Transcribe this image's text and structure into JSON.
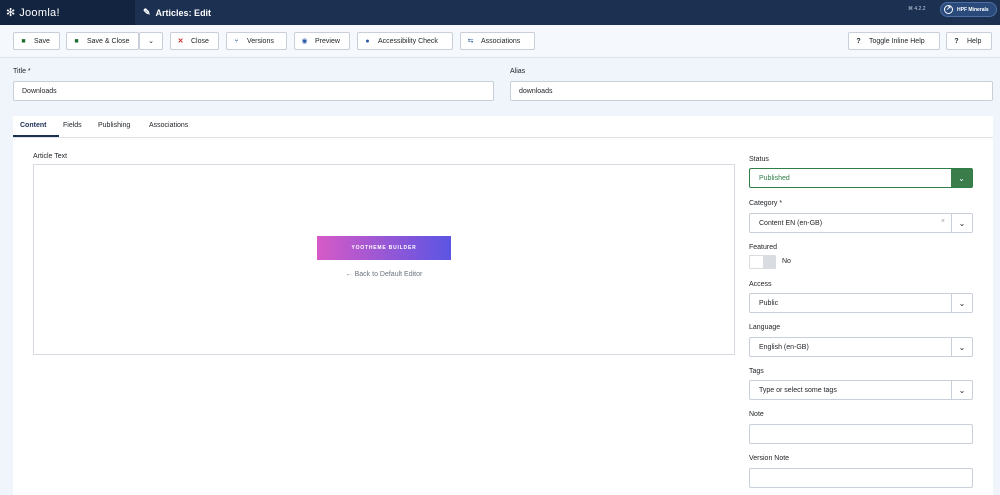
{
  "header": {
    "app_name": "Joomla!",
    "logo_icon": "joomla-logo-icon",
    "page_title": "Articles: Edit",
    "title_icon": "pencil-icon",
    "version": "⌘ 4.2.2",
    "site_name": "HPF Minerals",
    "site_icon": "external-link-icon"
  },
  "toolbar": {
    "save": "Save",
    "save_close": "Save & Close",
    "close": "Close",
    "versions": "Versions",
    "preview": "Preview",
    "accessibility": "Accessibility Check",
    "associations": "Associations",
    "toggle_help": "Toggle Inline Help",
    "help": "Help"
  },
  "form": {
    "title_label": "Title *",
    "title_value": "Downloads",
    "alias_label": "Alias",
    "alias_value": "downloads"
  },
  "tabs": {
    "content": "Content",
    "fields": "Fields",
    "publishing": "Publishing",
    "associations": "Associations",
    "active": "Content"
  },
  "editor": {
    "label": "Article Text",
    "builder_button": "YOOTHEME BUILDER",
    "back_link": "← Back to Default Editor"
  },
  "sidebar": {
    "status_label": "Status",
    "status_value": "Published",
    "category_label": "Category *",
    "category_value": "Content EN (en-GB)",
    "featured_label": "Featured",
    "featured_value": "No",
    "access_label": "Access",
    "access_value": "Public",
    "language_label": "Language",
    "language_value": "English (en-GB)",
    "tags_label": "Tags",
    "tags_placeholder": "Type or select some tags",
    "note_label": "Note",
    "note_value": "",
    "version_note_label": "Version Note",
    "version_note_value": ""
  },
  "colors": {
    "header_bg": "#1c3052",
    "status_green": "#3a7d4b",
    "builder_gradient_start": "#d65ac7",
    "builder_gradient_end": "#5b55e3"
  }
}
